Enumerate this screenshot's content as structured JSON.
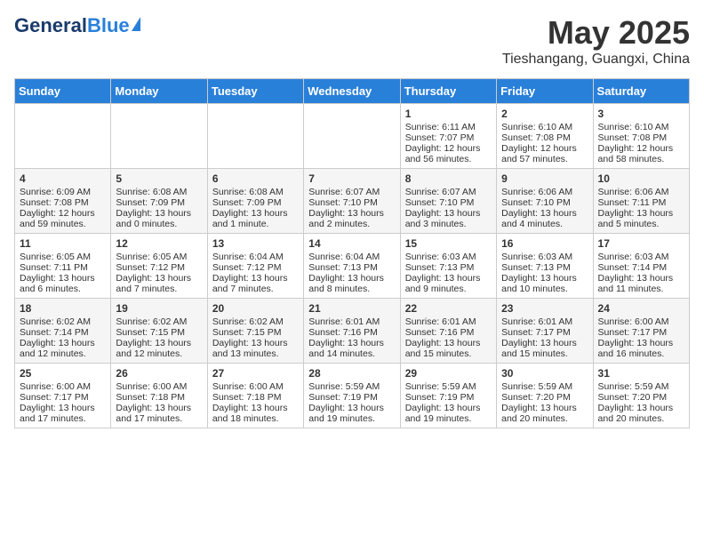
{
  "header": {
    "logo_general": "General",
    "logo_blue": "Blue",
    "month": "May 2025",
    "location": "Tieshangang, Guangxi, China"
  },
  "weekdays": [
    "Sunday",
    "Monday",
    "Tuesday",
    "Wednesday",
    "Thursday",
    "Friday",
    "Saturday"
  ],
  "weeks": [
    [
      {
        "day": "",
        "content": ""
      },
      {
        "day": "",
        "content": ""
      },
      {
        "day": "",
        "content": ""
      },
      {
        "day": "",
        "content": ""
      },
      {
        "day": "1",
        "content": "Sunrise: 6:11 AM\nSunset: 7:07 PM\nDaylight: 12 hours\nand 56 minutes."
      },
      {
        "day": "2",
        "content": "Sunrise: 6:10 AM\nSunset: 7:08 PM\nDaylight: 12 hours\nand 57 minutes."
      },
      {
        "day": "3",
        "content": "Sunrise: 6:10 AM\nSunset: 7:08 PM\nDaylight: 12 hours\nand 58 minutes."
      }
    ],
    [
      {
        "day": "4",
        "content": "Sunrise: 6:09 AM\nSunset: 7:08 PM\nDaylight: 12 hours\nand 59 minutes."
      },
      {
        "day": "5",
        "content": "Sunrise: 6:08 AM\nSunset: 7:09 PM\nDaylight: 13 hours\nand 0 minutes."
      },
      {
        "day": "6",
        "content": "Sunrise: 6:08 AM\nSunset: 7:09 PM\nDaylight: 13 hours\nand 1 minute."
      },
      {
        "day": "7",
        "content": "Sunrise: 6:07 AM\nSunset: 7:10 PM\nDaylight: 13 hours\nand 2 minutes."
      },
      {
        "day": "8",
        "content": "Sunrise: 6:07 AM\nSunset: 7:10 PM\nDaylight: 13 hours\nand 3 minutes."
      },
      {
        "day": "9",
        "content": "Sunrise: 6:06 AM\nSunset: 7:10 PM\nDaylight: 13 hours\nand 4 minutes."
      },
      {
        "day": "10",
        "content": "Sunrise: 6:06 AM\nSunset: 7:11 PM\nDaylight: 13 hours\nand 5 minutes."
      }
    ],
    [
      {
        "day": "11",
        "content": "Sunrise: 6:05 AM\nSunset: 7:11 PM\nDaylight: 13 hours\nand 6 minutes."
      },
      {
        "day": "12",
        "content": "Sunrise: 6:05 AM\nSunset: 7:12 PM\nDaylight: 13 hours\nand 7 minutes."
      },
      {
        "day": "13",
        "content": "Sunrise: 6:04 AM\nSunset: 7:12 PM\nDaylight: 13 hours\nand 7 minutes."
      },
      {
        "day": "14",
        "content": "Sunrise: 6:04 AM\nSunset: 7:13 PM\nDaylight: 13 hours\nand 8 minutes."
      },
      {
        "day": "15",
        "content": "Sunrise: 6:03 AM\nSunset: 7:13 PM\nDaylight: 13 hours\nand 9 minutes."
      },
      {
        "day": "16",
        "content": "Sunrise: 6:03 AM\nSunset: 7:13 PM\nDaylight: 13 hours\nand 10 minutes."
      },
      {
        "day": "17",
        "content": "Sunrise: 6:03 AM\nSunset: 7:14 PM\nDaylight: 13 hours\nand 11 minutes."
      }
    ],
    [
      {
        "day": "18",
        "content": "Sunrise: 6:02 AM\nSunset: 7:14 PM\nDaylight: 13 hours\nand 12 minutes."
      },
      {
        "day": "19",
        "content": "Sunrise: 6:02 AM\nSunset: 7:15 PM\nDaylight: 13 hours\nand 12 minutes."
      },
      {
        "day": "20",
        "content": "Sunrise: 6:02 AM\nSunset: 7:15 PM\nDaylight: 13 hours\nand 13 minutes."
      },
      {
        "day": "21",
        "content": "Sunrise: 6:01 AM\nSunset: 7:16 PM\nDaylight: 13 hours\nand 14 minutes."
      },
      {
        "day": "22",
        "content": "Sunrise: 6:01 AM\nSunset: 7:16 PM\nDaylight: 13 hours\nand 15 minutes."
      },
      {
        "day": "23",
        "content": "Sunrise: 6:01 AM\nSunset: 7:17 PM\nDaylight: 13 hours\nand 15 minutes."
      },
      {
        "day": "24",
        "content": "Sunrise: 6:00 AM\nSunset: 7:17 PM\nDaylight: 13 hours\nand 16 minutes."
      }
    ],
    [
      {
        "day": "25",
        "content": "Sunrise: 6:00 AM\nSunset: 7:17 PM\nDaylight: 13 hours\nand 17 minutes."
      },
      {
        "day": "26",
        "content": "Sunrise: 6:00 AM\nSunset: 7:18 PM\nDaylight: 13 hours\nand 17 minutes."
      },
      {
        "day": "27",
        "content": "Sunrise: 6:00 AM\nSunset: 7:18 PM\nDaylight: 13 hours\nand 18 minutes."
      },
      {
        "day": "28",
        "content": "Sunrise: 5:59 AM\nSunset: 7:19 PM\nDaylight: 13 hours\nand 19 minutes."
      },
      {
        "day": "29",
        "content": "Sunrise: 5:59 AM\nSunset: 7:19 PM\nDaylight: 13 hours\nand 19 minutes."
      },
      {
        "day": "30",
        "content": "Sunrise: 5:59 AM\nSunset: 7:20 PM\nDaylight: 13 hours\nand 20 minutes."
      },
      {
        "day": "31",
        "content": "Sunrise: 5:59 AM\nSunset: 7:20 PM\nDaylight: 13 hours\nand 20 minutes."
      }
    ]
  ]
}
